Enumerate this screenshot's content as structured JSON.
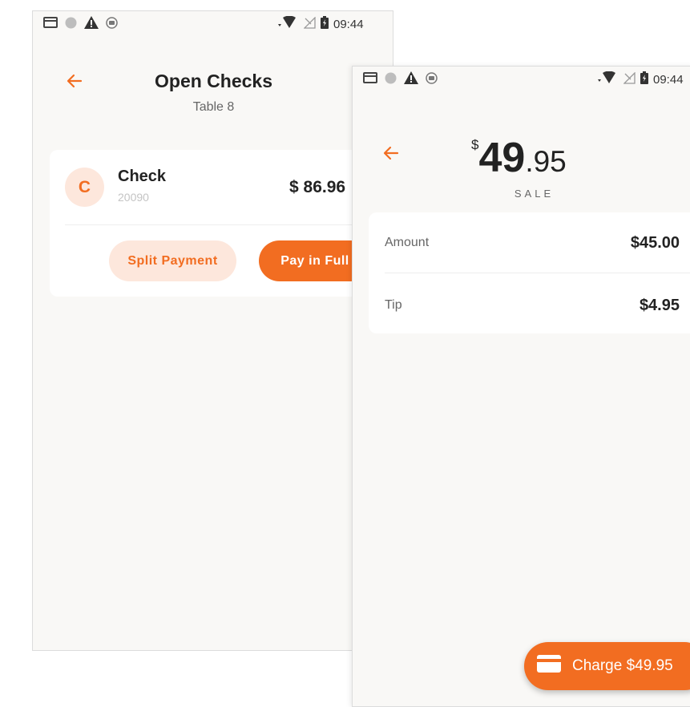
{
  "colors": {
    "accent": "#f26d21",
    "accent_light": "#fde7dc",
    "background": "#f9f8f6"
  },
  "screen_a": {
    "status_time": "09:44",
    "title": "Open Checks",
    "subtitle": "Table 8",
    "check": {
      "avatar_letter": "C",
      "name": "Check",
      "number": "20090",
      "amount": "$ 86.96"
    },
    "split_label": "Split Payment",
    "pay_full_label": "Pay in Full"
  },
  "screen_b": {
    "status_time": "09:44",
    "total_currency": "$",
    "total_dollars": "49",
    "total_cents": ".95",
    "total_type": "SALE",
    "rows": [
      {
        "label": "Amount",
        "value": "$45.00"
      },
      {
        "label": "Tip",
        "value": "$4.95"
      }
    ],
    "charge_label": "Charge $49.95"
  },
  "icons": [
    "card-icon",
    "circle-icon",
    "warning-icon",
    "sync-icon",
    "wifi-icon",
    "no-signal-icon",
    "battery-icon",
    "back-arrow-icon",
    "credit-card-icon"
  ]
}
